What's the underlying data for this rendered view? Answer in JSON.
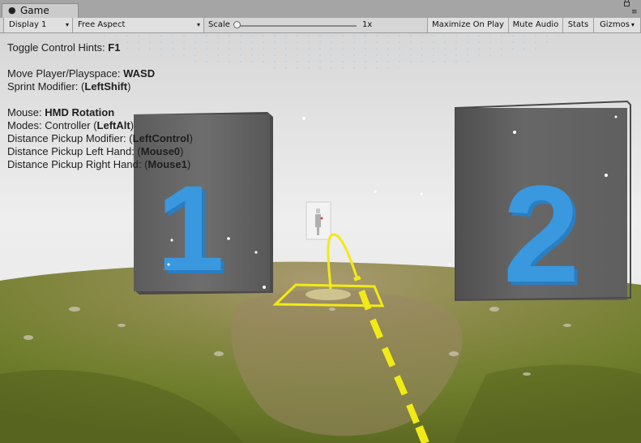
{
  "window": {
    "tab_label": "Game",
    "tab_icon": "pacman-game-icon"
  },
  "toolbar": {
    "display": "Display 1",
    "aspect": "Free Aspect",
    "scale_label": "Scale",
    "scale_value": "1x",
    "maximize_label": "Maximize On Play",
    "mute_label": "Mute Audio",
    "stats_label": "Stats",
    "gizmos_label": "Gizmos"
  },
  "hints": {
    "toggle": {
      "text": "Toggle Control Hints: ",
      "key": "F1"
    },
    "move": {
      "text": "Move Player/Playspace: ",
      "key": "WASD"
    },
    "sprint": {
      "text": "Sprint Modifier: (",
      "key": "LeftShift",
      "end": ")"
    },
    "mouse": {
      "text": "Mouse: ",
      "key": "HMD Rotation"
    },
    "modes": {
      "text": "Modes: Controller (",
      "key": "LeftAlt",
      "end": ")"
    },
    "pickup_mod": {
      "text": "Distance Pickup Modifier: (",
      "key": "LeftControl",
      "end": ")"
    },
    "pickup_left": {
      "text": "Distance Pickup Left Hand: (",
      "key": "Mouse0",
      "end": ")"
    },
    "pickup_right": {
      "text": "Distance Pickup Right Hand: (",
      "key": "Mouse1",
      "end": ")"
    }
  },
  "scene": {
    "left_number": "1",
    "right_number": "2",
    "colors": {
      "sky": "#e6e6e6",
      "ground": "#7d8a32",
      "block": "#626262",
      "digit": "#2f8fd6",
      "teleport": "#f2ea16"
    }
  }
}
